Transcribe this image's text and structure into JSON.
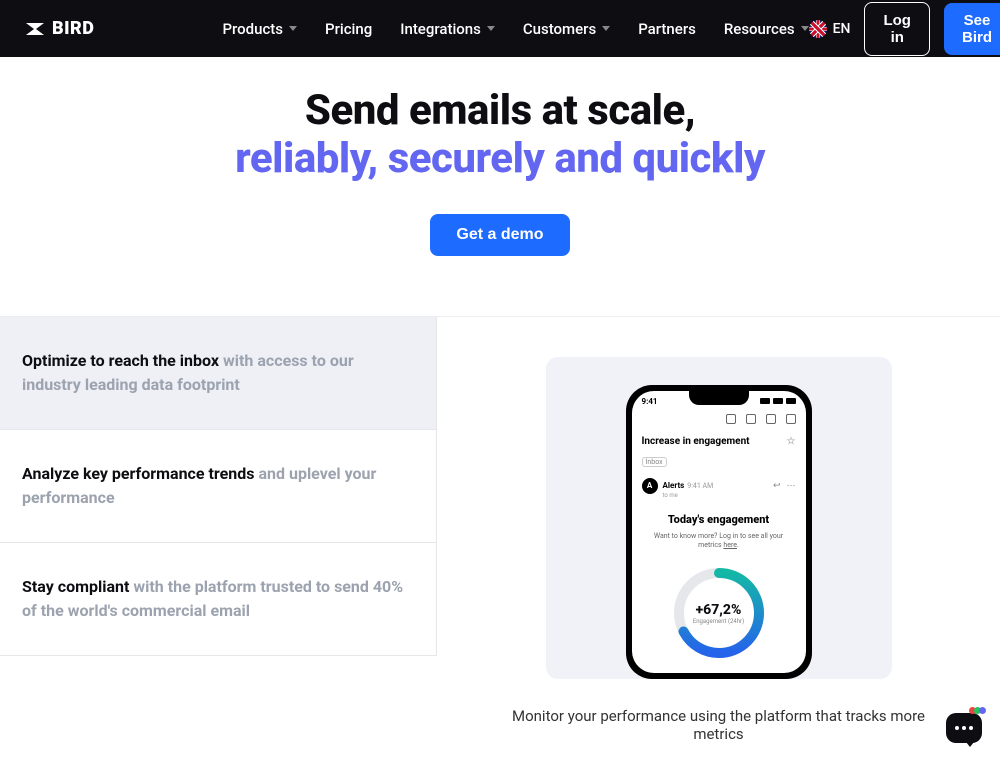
{
  "header": {
    "logo_text": "BIRD",
    "nav": {
      "products": "Products",
      "pricing": "Pricing",
      "integrations": "Integrations",
      "customers": "Customers",
      "partners": "Partners",
      "resources": "Resources"
    },
    "lang": "EN",
    "login": "Log in",
    "see_bird": "See Bird"
  },
  "hero": {
    "title_line1": "Send emails at scale,",
    "title_line2": "reliably, securely and quickly",
    "cta": "Get a demo"
  },
  "features": [
    {
      "strong": "Optimize to reach the inbox",
      "rest": " with access to our industry leading data footprint"
    },
    {
      "strong": "Analyze key performance trends",
      "rest": " and uplevel your performance"
    },
    {
      "strong": "Stay compliant",
      "rest": " with the platform trusted to send 40% of the world's commercial email"
    }
  ],
  "phone": {
    "time": "9:41",
    "subject": "Increase in engagement",
    "tag": "Inbox",
    "from": "Alerts",
    "from_time": "9:41 AM",
    "from_sub": "to me",
    "body_title": "Today's engagement",
    "body_text_pre": "Want to know more? Log in to see all your metrics ",
    "body_text_link": "here",
    "donut_value": "+67,2%",
    "donut_label": "Engagement (24hr)",
    "donut_percent": 67.2
  },
  "caption": "Monitor your performance using the platform that tracks more metrics"
}
